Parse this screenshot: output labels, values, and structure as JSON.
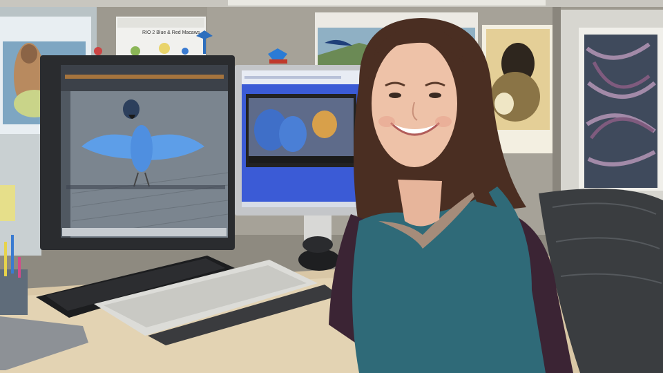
{
  "scene": {
    "description_free_labels": true,
    "poster_caption": "RIO 2 Blue & Red Macaws",
    "colors": {
      "cubicle_wall": "#9d998f",
      "desk": "#d9c7a6",
      "sweater": "#2f6a78",
      "hair": "#4a2e22",
      "chair": "#3a3d40",
      "monitor_frame": "#2a2c2f",
      "blue_screen": "#3b5bd6"
    }
  }
}
